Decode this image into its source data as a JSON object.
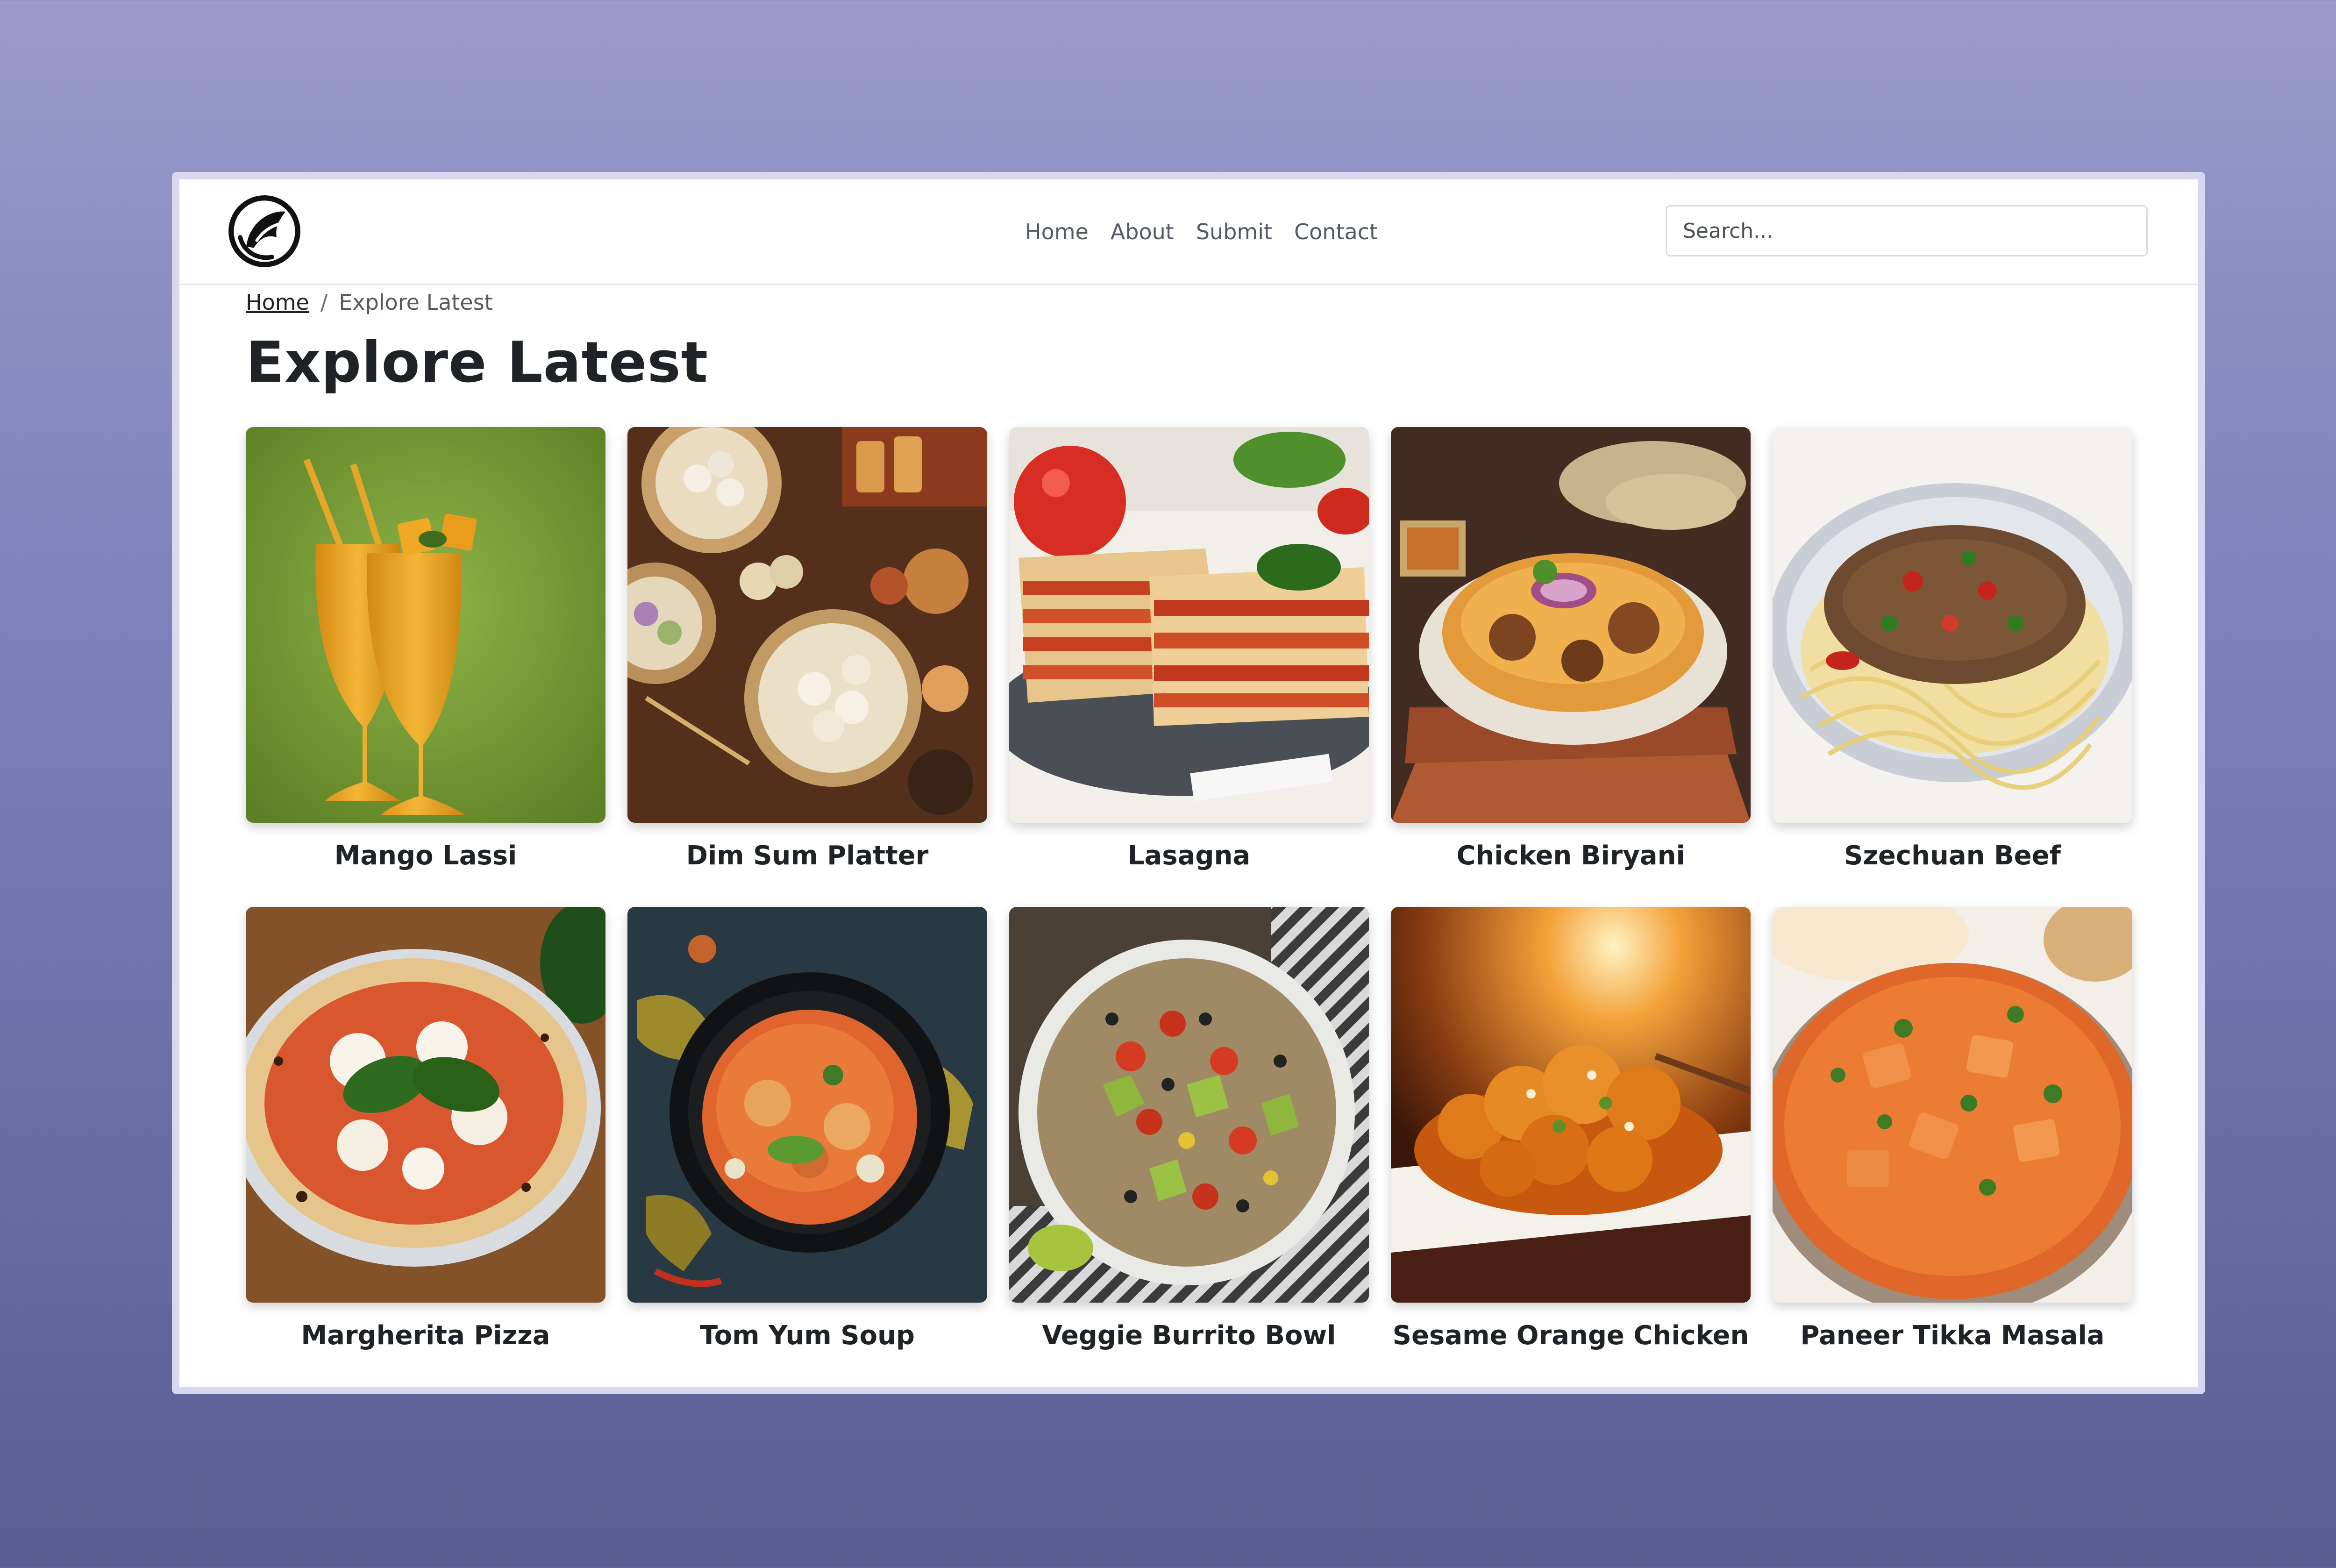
{
  "nav": {
    "links": [
      "Home",
      "About",
      "Submit",
      "Contact"
    ],
    "search_placeholder": "Search..."
  },
  "breadcrumb": {
    "home": "Home",
    "separator": "/",
    "current": "Explore Latest"
  },
  "page_title": "Explore Latest",
  "recipes": [
    {
      "title": "Mango Lassi",
      "image": "mango-lassi-photo"
    },
    {
      "title": "Dim Sum Platter",
      "image": "dim-sum-photo"
    },
    {
      "title": "Lasagna",
      "image": "lasagna-photo"
    },
    {
      "title": "Chicken Biryani",
      "image": "chicken-biryani-photo"
    },
    {
      "title": "Szechuan Beef",
      "image": "szechuan-beef-photo"
    },
    {
      "title": "Margherita Pizza",
      "image": "margherita-pizza-photo"
    },
    {
      "title": "Tom Yum Soup",
      "image": "tom-yum-soup-photo"
    },
    {
      "title": "Veggie Burrito Bowl",
      "image": "veggie-burrito-bowl-photo"
    },
    {
      "title": "Sesame Orange Chicken",
      "image": "sesame-orange-chicken-photo"
    },
    {
      "title": "Paneer Tikka Masala",
      "image": "paneer-tikka-masala-photo"
    }
  ],
  "colors": {
    "background_top": "#9a9bcb",
    "background_bottom": "#5a5d92",
    "text_dark": "#1f2227",
    "nav_text": "#545a63"
  }
}
